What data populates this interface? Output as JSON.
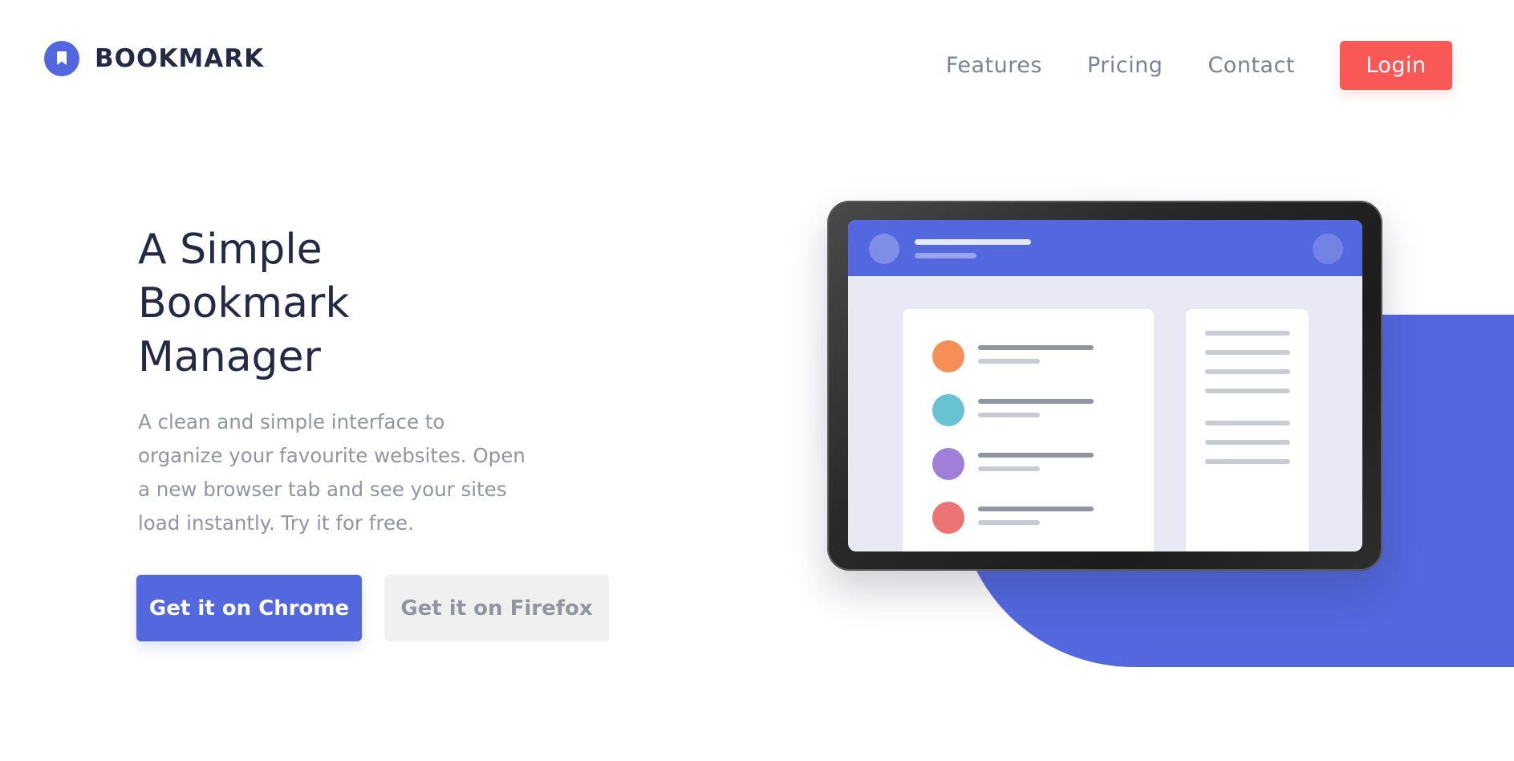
{
  "brand": {
    "name": "BOOKMARK",
    "icon": "bookmark-icon",
    "color": "#5368df"
  },
  "nav": {
    "links": [
      {
        "label": "Features"
      },
      {
        "label": "Pricing"
      },
      {
        "label": "Contact"
      }
    ],
    "login_label": "Login",
    "login_color": "#fa5757"
  },
  "hero": {
    "title_lines": [
      "A Simple",
      "Bookmark",
      "Manager"
    ],
    "description_lines": [
      "A clean and simple interface to",
      "organize your favourite websites. Open",
      "a new browser tab and see your sites",
      "load instantly. Try it for free."
    ],
    "chrome_button": "Get it on Chrome",
    "firefox_button": "Get it on Firefox"
  },
  "illustration": {
    "icon": "tablet-illustration",
    "dot_colors": [
      "#f78e56",
      "#67c2d4",
      "#a07fd9",
      "#ec7474"
    ],
    "accent_color": "#5368df"
  }
}
